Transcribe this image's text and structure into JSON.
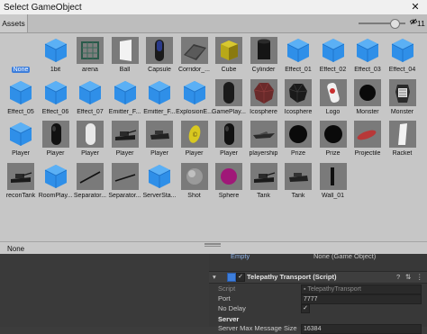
{
  "window": {
    "title": "Select GameObject",
    "close_glyph": "✕"
  },
  "toolbar": {
    "assets_tab": "Assets",
    "visibility_count": "11"
  },
  "assets": [
    {
      "label": "None",
      "kind": "none",
      "selected": true
    },
    {
      "label": "1bit",
      "kind": "cube"
    },
    {
      "label": "arena",
      "kind": "arena"
    },
    {
      "label": "Ball",
      "kind": "ball"
    },
    {
      "label": "Capsule",
      "kind": "capsule"
    },
    {
      "label": "Corridor_...",
      "kind": "corridor"
    },
    {
      "label": "Cube",
      "kind": "cubeModel"
    },
    {
      "label": "Cylinder",
      "kind": "cylinder"
    },
    {
      "label": "Effect_01",
      "kind": "cube"
    },
    {
      "label": "Effect_02",
      "kind": "cube"
    },
    {
      "label": "Effect_03",
      "kind": "cube"
    },
    {
      "label": "Effect_04",
      "kind": "cube"
    },
    {
      "label": "Effect_05",
      "kind": "cube"
    },
    {
      "label": "Effect_06",
      "kind": "cube"
    },
    {
      "label": "Effect_07",
      "kind": "cube"
    },
    {
      "label": "Emitter_F...",
      "kind": "cube"
    },
    {
      "label": "Emitter_F...",
      "kind": "cube"
    },
    {
      "label": "ExplosionE...",
      "kind": "cube"
    },
    {
      "label": "GamePlay...",
      "kind": "gameplay"
    },
    {
      "label": "Icosphere",
      "kind": "icosphereRed"
    },
    {
      "label": "Icosphere",
      "kind": "icosphere"
    },
    {
      "label": "Logo",
      "kind": "logo"
    },
    {
      "label": "Monster",
      "kind": "monster"
    },
    {
      "label": "Monster",
      "kind": "monster2"
    },
    {
      "label": "Player",
      "kind": "cube"
    },
    {
      "label": "Player",
      "kind": "capsuleBlack"
    },
    {
      "label": "Player",
      "kind": "capsuleWhite"
    },
    {
      "label": "Player",
      "kind": "tankDark"
    },
    {
      "label": "Player",
      "kind": "tankDark2"
    },
    {
      "label": "Player",
      "kind": "coin"
    },
    {
      "label": "Player",
      "kind": "capsuleBlack"
    },
    {
      "label": "playership",
      "kind": "ship"
    },
    {
      "label": "Prize",
      "kind": "sphereBlack"
    },
    {
      "label": "Prize",
      "kind": "sphereBlack"
    },
    {
      "label": "Projectile",
      "kind": "projectile"
    },
    {
      "label": "Racket",
      "kind": "racket"
    },
    {
      "label": "reconTank",
      "kind": "tankDark"
    },
    {
      "label": "RoomPlay...",
      "kind": "cube"
    },
    {
      "label": "Separator...",
      "kind": "stick"
    },
    {
      "label": "Separator...",
      "kind": "stick2"
    },
    {
      "label": "ServerSta...",
      "kind": "cube"
    },
    {
      "label": "Shot",
      "kind": "sphereGrey"
    },
    {
      "label": "Sphere",
      "kind": "spherePurple"
    },
    {
      "label": "Tank",
      "kind": "tankDark"
    },
    {
      "label": "Tank",
      "kind": "tankDark2"
    },
    {
      "label": "Wall_01",
      "kind": "wall"
    }
  ],
  "status": {
    "selection": "None"
  },
  "inspector": {
    "empty_label": "Empty",
    "empty_value": "None (Game Object)",
    "component_title": "Telepathy Transport (Script)",
    "script_label": "Script",
    "script_value": "TelepathyTransport",
    "port_label": "Port",
    "port_value": "7777",
    "nodelay_label": "No Delay",
    "nodelay_check": "✓",
    "server_header": "Server",
    "server_row_label": "Server Max Message Size",
    "server_row_value": "16384"
  },
  "colors": {
    "cube_blue": "#2f8fe8",
    "selection": "#3d7edb"
  }
}
